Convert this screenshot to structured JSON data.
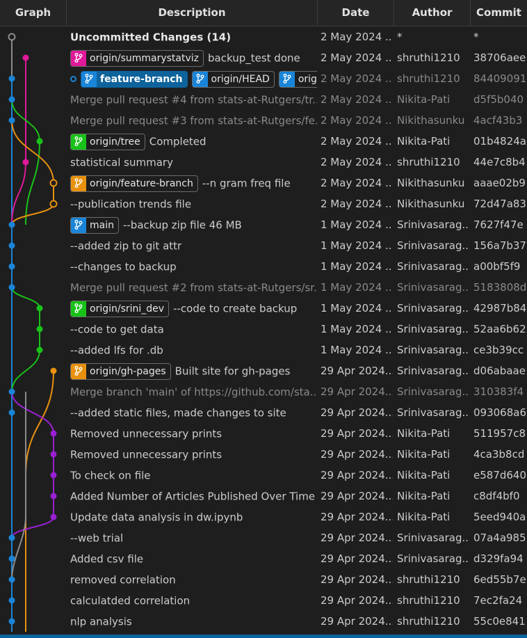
{
  "header": {
    "graph": "Graph",
    "description": "Description",
    "date": "Date",
    "author": "Author",
    "commit": "Commit"
  },
  "lane_colors": [
    "#1a85d8",
    "#e0199a",
    "#19c219",
    "#e8910e",
    "#9b1fd4",
    "#8c8c8c"
  ],
  "commits": [
    {
      "message": "Uncommitted Changes (14)",
      "bold": true,
      "date": "2 May 2024 ...",
      "author": "*",
      "commit": "*",
      "refs": []
    },
    {
      "message": "backup_test done",
      "date": "2 May 2024 ...",
      "author": "shruthi1210",
      "commit": "38706aee",
      "refs": [
        {
          "label": "origin/summarystatviz",
          "color": "#e0199a",
          "icon": "branch-icon"
        }
      ]
    },
    {
      "message": "",
      "dim": true,
      "head": true,
      "date": "2 May 2024 ...",
      "author": "shruthi1210",
      "commit": "84409091",
      "refs": [
        {
          "label": "feature-branch",
          "color": "#1a85d8",
          "icon": "branch-icon",
          "filled": true
        },
        {
          "label": "origin/HEAD",
          "color": "#1a85d8",
          "icon": "branch-icon"
        },
        {
          "label": "origi",
          "color": "#1a85d8",
          "icon": "branch-icon"
        }
      ]
    },
    {
      "message": "Merge pull request #4 from stats-at-Rutgers/tr...",
      "dim": true,
      "date": "2 May 2024 ...",
      "author": "Nikita-Pati",
      "commit": "d5f5b040",
      "refs": []
    },
    {
      "message": "Merge pull request #3 from stats-at-Rutgers/fe...",
      "dim": true,
      "date": "2 May 2024 ...",
      "author": "Nikithasunku",
      "commit": "4acf43b3",
      "refs": []
    },
    {
      "message": "Completed",
      "date": "2 May 2024 ...",
      "author": "Nikita-Pati",
      "commit": "01b4824a",
      "refs": [
        {
          "label": "origin/tree",
          "color": "#19c219",
          "icon": "branch-icon"
        }
      ]
    },
    {
      "message": "statistical summary",
      "date": "2 May 2024 ...",
      "author": "shruthi1210",
      "commit": "44e7c8b4",
      "refs": []
    },
    {
      "message": "--n gram freq file",
      "date": "2 May 2024 ...",
      "author": "Nikithasunku",
      "commit": "aaae02b9",
      "refs": [
        {
          "label": "origin/feature-branch",
          "color": "#e8910e",
          "icon": "branch-icon"
        }
      ]
    },
    {
      "message": "--publication trends file",
      "date": "2 May 2024 ...",
      "author": "Nikithasunku",
      "commit": "72d47a83",
      "refs": []
    },
    {
      "message": "--backup zip file 46 MB",
      "date": "1 May 2024 ...",
      "author": "Srinivasarag...",
      "commit": "7627f47e",
      "refs": [
        {
          "label": "main",
          "color": "#1a85d8",
          "icon": "branch-icon"
        }
      ]
    },
    {
      "message": "--added zip to git attr",
      "date": "1 May 2024 ...",
      "author": "Srinivasarag...",
      "commit": "156a7b37",
      "refs": []
    },
    {
      "message": "--changes to backup",
      "date": "1 May 2024 ...",
      "author": "Srinivasarag...",
      "commit": "a00bf5f9",
      "refs": []
    },
    {
      "message": "Merge pull request #2 from stats-at-Rutgers/sr...",
      "dim": true,
      "date": "1 May 2024 ...",
      "author": "Srinivasarag...",
      "commit": "5183808d",
      "refs": []
    },
    {
      "message": "--code to create backup",
      "date": "1 May 2024 ...",
      "author": "Srinivasarag...",
      "commit": "42987b84",
      "refs": [
        {
          "label": "origin/srini_dev",
          "color": "#19c219",
          "icon": "branch-icon"
        }
      ]
    },
    {
      "message": "--code to get data",
      "date": "1 May 2024 ...",
      "author": "Srinivasarag...",
      "commit": "52aa6b62",
      "refs": []
    },
    {
      "message": "--added lfs for .db",
      "date": "1 May 2024 ...",
      "author": "Srinivasarag...",
      "commit": "ce3b39cc",
      "refs": []
    },
    {
      "message": "Built site for gh-pages",
      "date": "29 Apr 2024...",
      "author": "Srinivasarag...",
      "commit": "d06abaae",
      "refs": [
        {
          "label": "origin/gh-pages",
          "color": "#e8910e",
          "icon": "branch-icon"
        }
      ]
    },
    {
      "message": "Merge branch 'main' of https://github.com/sta...",
      "dim": true,
      "date": "29 Apr 2024...",
      "author": "Srinivasarag...",
      "commit": "310383f4",
      "refs": []
    },
    {
      "message": "--added static files, made changes to site",
      "date": "29 Apr 2024...",
      "author": "Srinivasarag...",
      "commit": "093068a6",
      "refs": []
    },
    {
      "message": "Removed unnecessary prints",
      "date": "29 Apr 2024...",
      "author": "Nikita-Pati",
      "commit": "511957c8",
      "refs": []
    },
    {
      "message": "Removed unnecessary prints",
      "date": "29 Apr 2024...",
      "author": "Nikita-Pati",
      "commit": "4ca3b8cd",
      "refs": []
    },
    {
      "message": "To check on file",
      "date": "29 Apr 2024...",
      "author": "Nikita-Pati",
      "commit": "e587d640",
      "refs": []
    },
    {
      "message": "Added Number of Articles Published Over Time",
      "date": "29 Apr 2024...",
      "author": "Nikita-Pati",
      "commit": "c8df4bf0",
      "refs": []
    },
    {
      "message": "Update data analysis in dw.ipynb",
      "date": "29 Apr 2024...",
      "author": "Nikita-Pati",
      "commit": "5eed940a",
      "refs": []
    },
    {
      "message": "--web trial",
      "date": "29 Apr 2024...",
      "author": "Srinivasarag...",
      "commit": "07a4a985",
      "refs": []
    },
    {
      "message": "Added csv file",
      "date": "29 Apr 2024...",
      "author": "Srinivasarag...",
      "commit": "d329fa94",
      "refs": []
    },
    {
      "message": "removed correlation",
      "date": "29 Apr 2024...",
      "author": "shruthi1210",
      "commit": "6ed55b7e",
      "refs": []
    },
    {
      "message": "calculatded correlation",
      "date": "29 Apr 2024...",
      "author": "shruthi1210",
      "commit": "7ec2fa24",
      "refs": []
    },
    {
      "message": "nlp analysis",
      "date": "29 Apr 2024...",
      "author": "shruthi1210",
      "commit": "55c0e841",
      "refs": []
    }
  ]
}
